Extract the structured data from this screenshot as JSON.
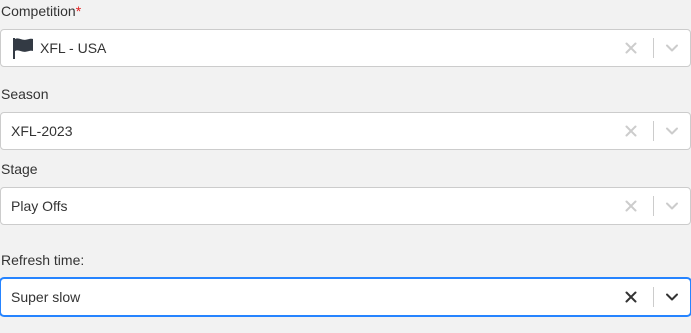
{
  "competition": {
    "label": "Competition",
    "required_mark": "*",
    "value": "XFL - USA",
    "flag_icon": "flag-icon"
  },
  "season": {
    "label": "Season",
    "value": "XFL-2023"
  },
  "stage": {
    "label": "Stage",
    "value": "Play Offs"
  },
  "refresh_time": {
    "label": "Refresh time:",
    "value": "Super slow",
    "focused": true
  },
  "colors": {
    "background": "#f2f2f2",
    "required": "#e02020",
    "focus_border": "#2684ff",
    "icon_muted": "#cccccc",
    "icon_active": "#333333"
  }
}
